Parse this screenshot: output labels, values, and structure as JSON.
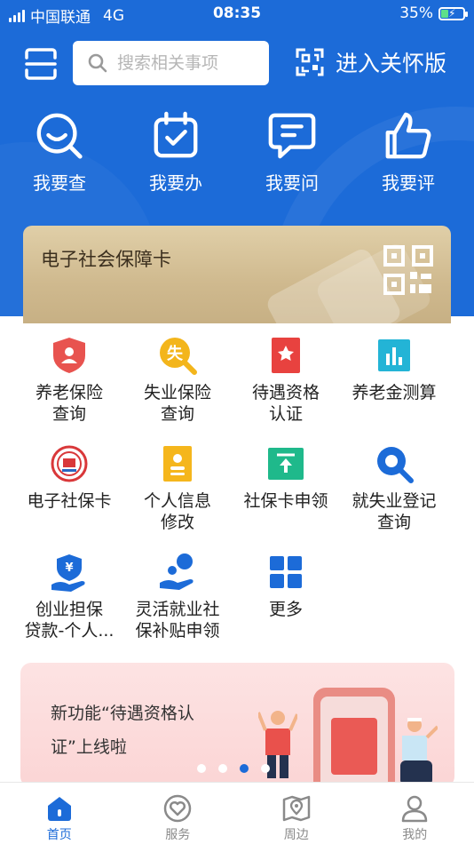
{
  "status_bar": {
    "carrier": "中国联通",
    "network": "4G",
    "time": "08:35",
    "battery": "35%",
    "battery_level": 0.35
  },
  "header": {
    "search_placeholder": "搜索相关事项",
    "care_mode": "进入关怀版",
    "quick_actions": [
      {
        "label": "我要查",
        "icon": "search-face-icon"
      },
      {
        "label": "我要办",
        "icon": "calendar-check-icon"
      },
      {
        "label": "我要问",
        "icon": "chat-icon"
      },
      {
        "label": "我要评",
        "icon": "thumbs-up-icon"
      }
    ]
  },
  "card": {
    "title": "电子社会保障卡"
  },
  "services": [
    {
      "line1": "养老保险",
      "line2": "查询",
      "icon": "pension-shield-icon",
      "color": "#e8534f"
    },
    {
      "line1": "失业保险",
      "line2": "查询",
      "icon": "unemployment-search-icon",
      "color": "#f3b51b"
    },
    {
      "line1": "待遇资格",
      "line2": "认证",
      "icon": "bookmark-star-icon",
      "color": "#e8423f"
    },
    {
      "line1": "养老金测算",
      "line2": "",
      "icon": "bar-chart-icon",
      "color": "#23b4d6"
    },
    {
      "line1": "电子社保卡",
      "line2": "",
      "icon": "social-security-emblem-icon",
      "color": "#d9383a"
    },
    {
      "line1": "个人信息",
      "line2": "修改",
      "icon": "id-card-icon",
      "color": "#f5b61c"
    },
    {
      "line1": "社保卡申领",
      "line2": "",
      "icon": "card-upload-icon",
      "color": "#1fb98b"
    },
    {
      "line1": "就失业登记",
      "line2": "查询",
      "icon": "magnifier-icon",
      "color": "#1c6bd8"
    },
    {
      "line1": "创业担保",
      "line2": "贷款-个人...",
      "icon": "yen-hand-icon",
      "color": "#1c6bd8"
    },
    {
      "line1": "灵活就业社",
      "line2": "保补贴申领",
      "icon": "coin-hand-icon",
      "color": "#1c6bd8"
    },
    {
      "line1": "更多",
      "line2": "",
      "icon": "grid-more-icon",
      "color": "#1c6bd8"
    }
  ],
  "banner": {
    "text": "新功能“待遇资格认证”上线啦"
  },
  "tabbar": [
    {
      "label": "首页",
      "icon": "home-icon",
      "active": true
    },
    {
      "label": "服务",
      "icon": "heart-circle-icon",
      "active": false
    },
    {
      "label": "周边",
      "icon": "map-pin-icon",
      "active": false
    },
    {
      "label": "我的",
      "icon": "user-icon",
      "active": false
    }
  ],
  "colors": {
    "brand": "#1c6bd8",
    "card_gold": "#d6c398",
    "banner_pink": "#fbd9d9"
  }
}
